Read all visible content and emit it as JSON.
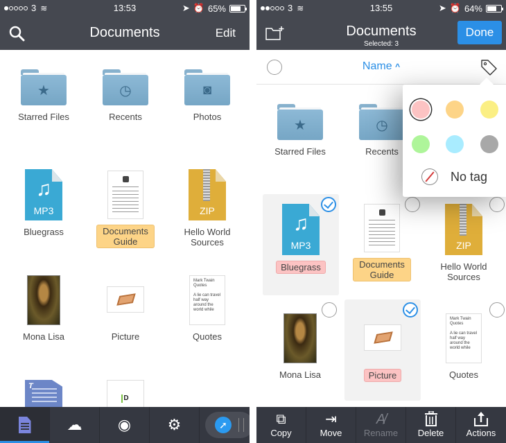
{
  "left": {
    "status": {
      "carrier": "3",
      "signal_bars": 1,
      "time": "13:53",
      "battery": "65%",
      "battery_level": 0.65
    },
    "header": {
      "title": "Documents",
      "edit_label": "Edit",
      "left_icon": "search-icon"
    },
    "items": [
      {
        "name": "Starred Files",
        "type": "folder",
        "icon": "star-icon"
      },
      {
        "name": "Recents",
        "type": "folder",
        "icon": "clock-icon"
      },
      {
        "name": "Photos",
        "type": "folder",
        "icon": "camera-icon"
      },
      {
        "name": "Bluegrass",
        "type": "mp3",
        "ext": "MP3"
      },
      {
        "name": "Documents Guide",
        "type": "pdf",
        "tag": "orange"
      },
      {
        "name": "Hello World Sources",
        "type": "zip",
        "ext": "ZIP"
      },
      {
        "name": "Mona Lisa",
        "type": "image"
      },
      {
        "name": "Picture",
        "type": "image"
      },
      {
        "name": "Quotes",
        "type": "text",
        "preview_title": "Mark Twain Quotes",
        "preview_body": "A lie can travel half way around the world while"
      },
      {
        "name": "",
        "type": "txt",
        "glyph": "T"
      },
      {
        "name": "",
        "type": "pdf-d",
        "glyph": "D"
      }
    ],
    "tabbar": [
      {
        "name": "documents-tab",
        "icon": "document-icon",
        "active": true
      },
      {
        "name": "cloud-tab",
        "icon": "cloud-icon",
        "glyph": "☁"
      },
      {
        "name": "wifi-transfer-tab",
        "icon": "wifi-icon",
        "glyph": "◉"
      },
      {
        "name": "settings-tab",
        "icon": "gear-icon",
        "glyph": "⚙"
      },
      {
        "name": "browser-tab",
        "icon": "compass-icon",
        "glyph": "➚"
      }
    ]
  },
  "right": {
    "status": {
      "carrier": "3",
      "signal_bars": 2,
      "time": "13:55",
      "battery": "64%",
      "battery_level": 0.64
    },
    "header": {
      "title": "Documents",
      "subtitle": "Selected: 3",
      "done_label": "Done",
      "left_icon": "new-folder-icon"
    },
    "sortbar": {
      "label": "Name",
      "direction_glyph": "⌃"
    },
    "items": [
      {
        "name": "Starred Files",
        "type": "folder",
        "icon": "star-icon"
      },
      {
        "name": "Recents",
        "type": "folder",
        "icon": "clock-icon"
      },
      {
        "name": "Bluegrass",
        "type": "mp3",
        "ext": "MP3",
        "tag": "red",
        "selected": true
      },
      {
        "name": "Documents Guide",
        "type": "pdf",
        "tag": "orange",
        "selected": false
      },
      {
        "name": "Hello World Sources",
        "type": "zip",
        "ext": "ZIP",
        "selected": false
      },
      {
        "name": "Mona Lisa",
        "type": "image",
        "selected": false
      },
      {
        "name": "Picture",
        "type": "image",
        "tag": "red",
        "selected": true
      },
      {
        "name": "Quotes",
        "type": "text",
        "preview_title": "Mark Twain Quotes",
        "preview_body": "A lie can travel half way around the world while",
        "selected": false
      }
    ],
    "tag_popover": {
      "colors": [
        {
          "name": "red",
          "hex": "#fcc3c3",
          "selected": true
        },
        {
          "name": "orange",
          "hex": "#fdd487"
        },
        {
          "name": "yellow",
          "hex": "#fbef84"
        },
        {
          "name": "green",
          "hex": "#aef59a"
        },
        {
          "name": "blue",
          "hex": "#a9ecff"
        },
        {
          "name": "gray",
          "hex": "#a8a8a8"
        }
      ],
      "no_tag_label": "No tag"
    },
    "actions": [
      {
        "label": "Copy",
        "icon": "copy-icon",
        "glyph": "⧉"
      },
      {
        "label": "Move",
        "icon": "move-icon",
        "glyph": "⇥"
      },
      {
        "label": "Rename",
        "icon": "rename-icon",
        "glyph": "A̸",
        "disabled": true
      },
      {
        "label": "Delete",
        "icon": "trash-icon",
        "glyph": "🗑"
      },
      {
        "label": "Actions",
        "icon": "share-icon",
        "glyph": "⇪"
      }
    ]
  },
  "colors": {
    "header_bg": "#454850",
    "accent": "#2b8fe6",
    "tabbar_bg": "#353841"
  }
}
